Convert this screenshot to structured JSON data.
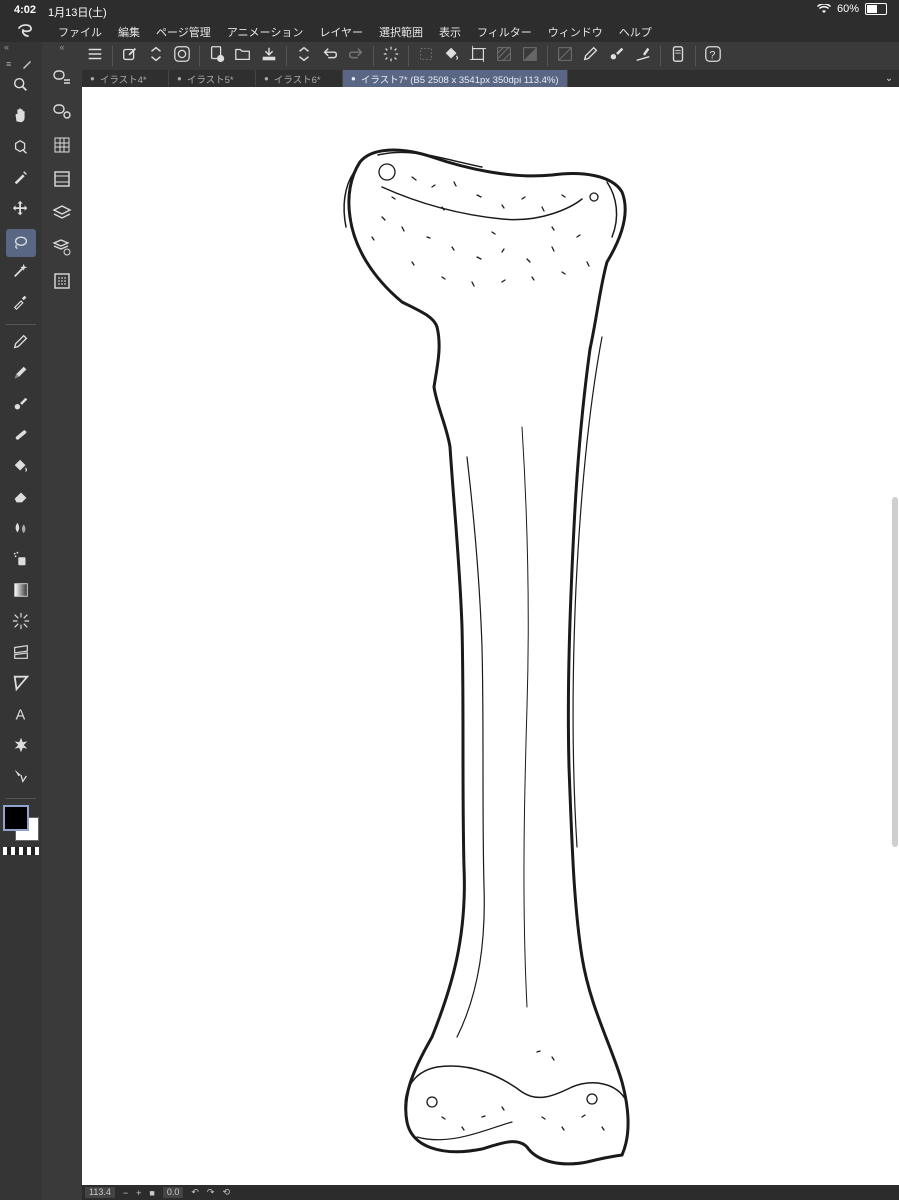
{
  "status": {
    "time": "4:02",
    "date": "1月13日(土)",
    "battery": "60%",
    "battery_level": 0.6
  },
  "menu": [
    "ファイル",
    "編集",
    "ページ管理",
    "アニメーション",
    "レイヤー",
    "選択範囲",
    "表示",
    "フィルター",
    "ウィンドウ",
    "ヘルプ"
  ],
  "tabs": [
    {
      "label": "イラスト4*",
      "active": false
    },
    {
      "label": "イラスト5*",
      "active": false
    },
    {
      "label": "イラスト6*",
      "active": false
    },
    {
      "label": "イラスト7* (B5 2508 x 3541px 350dpi 113.4%)",
      "active": true
    }
  ],
  "bottom": {
    "zoom": "113.4",
    "minus": "−",
    "plus": "+",
    "angle": "0.0"
  },
  "colors": {
    "main": "#000000",
    "sub": "#ffffff",
    "accent": "#5a6784"
  },
  "tools": [
    "zoom-icon",
    "hand-icon",
    "rotate-icon",
    "operation-icon",
    "move-icon",
    "lasso-icon",
    "magic-wand-icon",
    "eyedropper-icon",
    "pen-icon",
    "pencil-icon",
    "brush-icon",
    "airbrush-icon",
    "fill-icon",
    "eraser-icon",
    "blend-icon",
    "spray-icon",
    "gradient-icon",
    "effect-line-icon",
    "frame-icon",
    "figure-icon",
    "text-icon",
    "balloon-icon",
    "line-edit-icon"
  ],
  "subtools": [
    "sub-tool-icon",
    "tool-property-icon",
    "color-set-icon",
    "animation-icon",
    "layer-icon",
    "layer-property-icon",
    "timeline-icon"
  ],
  "toolbar_icons": [
    "menu-icon",
    "new-canvas-icon",
    "updown-icon",
    "ring-icon",
    "add-page-icon",
    "open-icon",
    "save-icon",
    "updown-icon",
    "undo-icon",
    "redo-icon",
    "loading-icon",
    "crop-icon",
    "fill-icon",
    "transform-icon",
    "hatching-icon",
    "tone-icon",
    "ruler-icon",
    "pen-icon",
    "brush-icon",
    "straight-icon",
    "device-icon",
    "help-icon"
  ]
}
